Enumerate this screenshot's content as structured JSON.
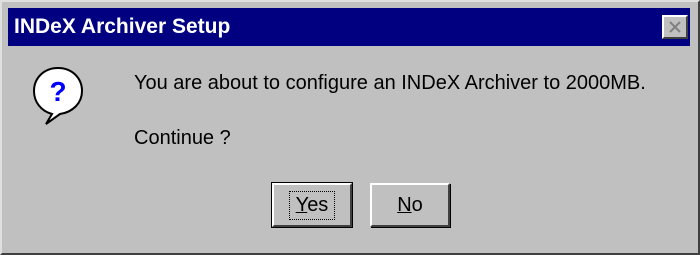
{
  "window": {
    "title": "INDeX Archiver Setup",
    "close_icon": "close-icon"
  },
  "icon": "question-icon",
  "message": {
    "text": "You are about to configure an INDeX Archiver to 2000MB.",
    "prompt": "Continue ?"
  },
  "buttons": {
    "yes_first": "Y",
    "yes_rest": "es",
    "no_first": "N",
    "no_rest": "o"
  },
  "colors": {
    "titlebar": "#000080",
    "face": "#c0c0c0",
    "icon_blue": "#0000ff"
  }
}
